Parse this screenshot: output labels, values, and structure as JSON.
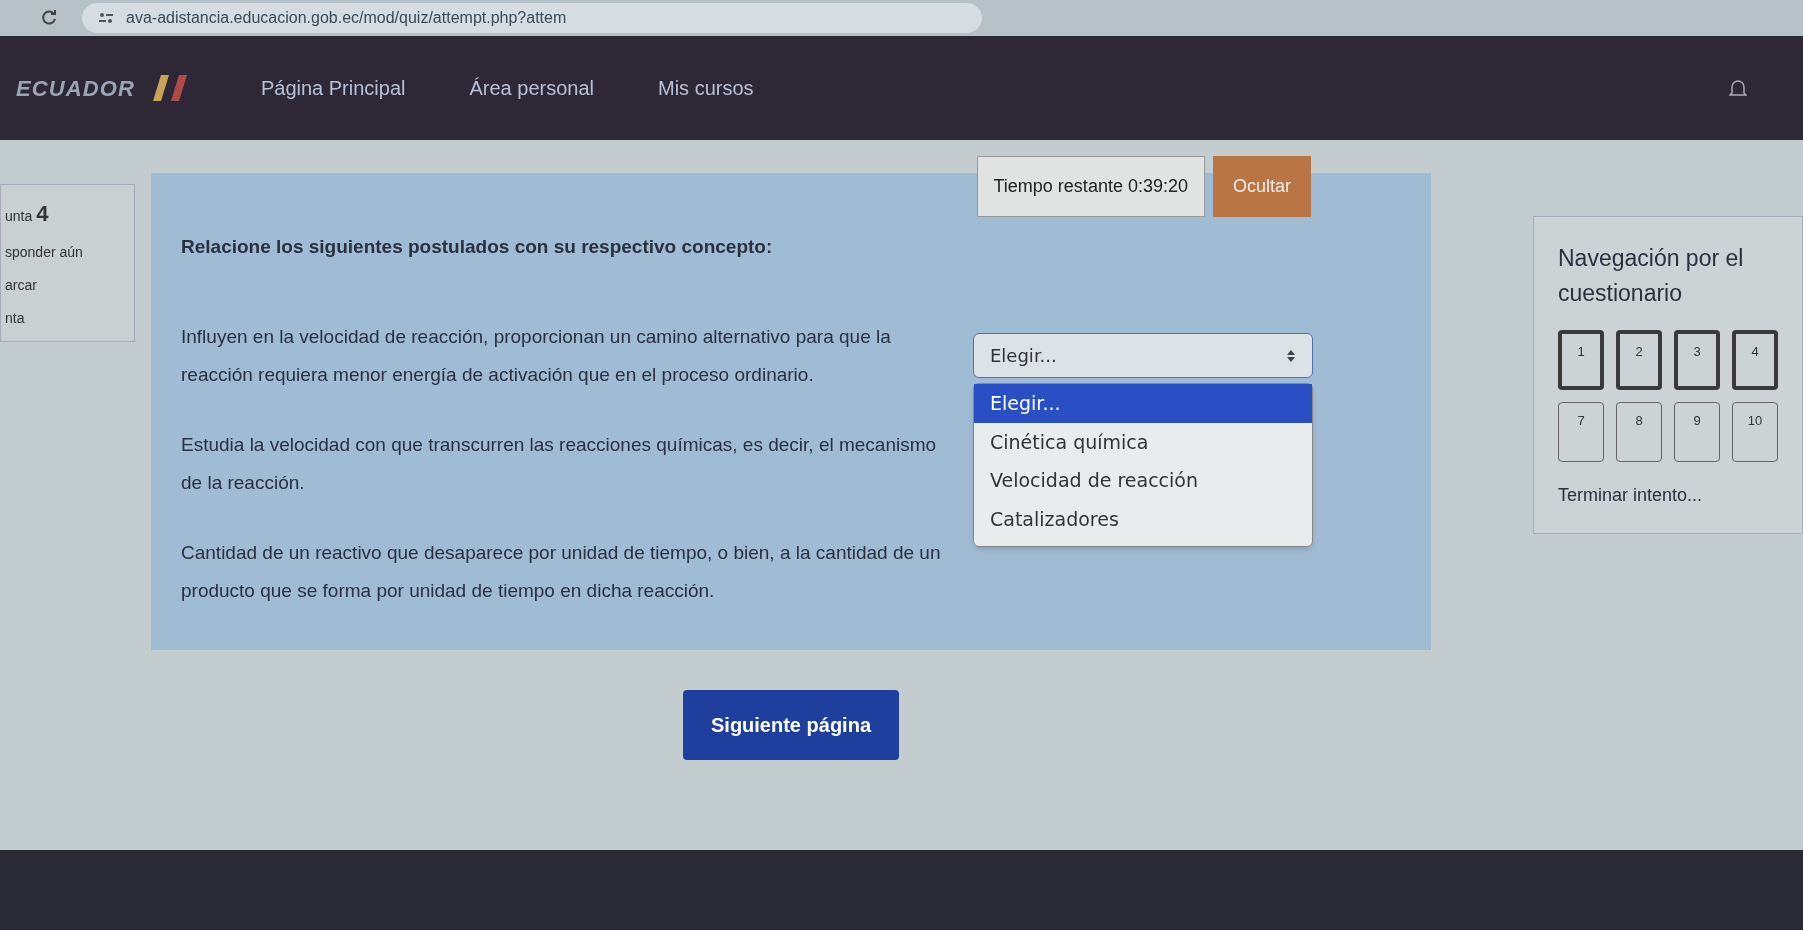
{
  "browser": {
    "url": "ava-adistancia.educacion.gob.ec/mod/quiz/attempt.php?attem"
  },
  "navbar": {
    "logo": "ECUADOR",
    "links": [
      "Página Principal",
      "Área personal",
      "Mis cursos"
    ]
  },
  "timer": {
    "label": "Tiempo restante 0:39:20",
    "button": "Ocultar"
  },
  "question_info": {
    "number_label": "unta",
    "number": "4",
    "lines": [
      "sponder aún",
      "arcar",
      "nta"
    ]
  },
  "question": {
    "prompt": "Relacione los siguientes postulados con su respectivo concepto:",
    "rows": [
      {
        "text": "Influyen en la velocidad de reacción, proporcionan un camino alternativo para que la reacción requiera menor energía de activación que en el proceso ordinario.",
        "select": "Elegir...",
        "expanded": true
      },
      {
        "text": "Estudia la velocidad con que transcurren las reacciones químicas, es decir, el mecanismo de la reacción.",
        "select": null
      },
      {
        "text": "Cantidad de un reactivo que desaparece por unidad de tiempo, o bien, a la cantidad de un producto que se forma por unidad de tiempo en dicha reacción.",
        "select": null
      }
    ],
    "options": [
      {
        "label": "Elegir...",
        "selected": true
      },
      {
        "label": "Cinética química",
        "selected": false
      },
      {
        "label": "Velocidad de reacción",
        "selected": false
      },
      {
        "label": "Catalizadores",
        "selected": false
      }
    ]
  },
  "quiz_navigation": {
    "title": "Navegación por el cuestionario",
    "rows": [
      [
        {
          "label": "1",
          "current": true
        },
        {
          "label": "2",
          "current": true
        },
        {
          "label": "3",
          "current": true
        },
        {
          "label": "4",
          "current": true
        }
      ],
      [
        {
          "label": "7",
          "current": false
        },
        {
          "label": "8",
          "current": false
        },
        {
          "label": "9",
          "current": false
        },
        {
          "label": "10",
          "current": false
        }
      ]
    ],
    "finish_link": "Terminar intento..."
  },
  "next_button": "Siguiente página"
}
